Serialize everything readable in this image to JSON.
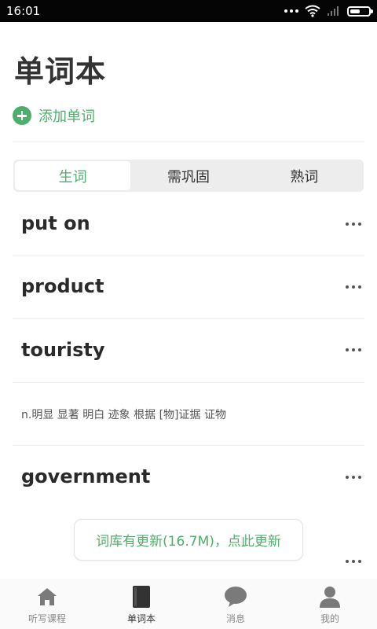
{
  "status_bar": {
    "time": "16:01"
  },
  "page": {
    "title": "单词本"
  },
  "add_word": {
    "label": "添加单词"
  },
  "tabs": [
    {
      "label": "生词",
      "active": true
    },
    {
      "label": "需巩固",
      "active": false
    },
    {
      "label": "熟词",
      "active": false
    }
  ],
  "words": [
    {
      "text": "put on"
    },
    {
      "text": "product"
    },
    {
      "text": "touristy"
    },
    {
      "definition": "n.明显 显著 明白 迹象 根据 [物]证据 证物"
    },
    {
      "text": "government"
    }
  ],
  "update_toast": {
    "text": "词库有更新(16.7M)，点此更新"
  },
  "bottom_nav": [
    {
      "label": "听写课程",
      "icon": "home-icon",
      "active": false
    },
    {
      "label": "单词本",
      "icon": "book-icon",
      "active": true
    },
    {
      "label": "消息",
      "icon": "chat-bubble-icon",
      "active": false
    },
    {
      "label": "我的",
      "icon": "person-icon",
      "active": false
    }
  ],
  "colors": {
    "accent": "#4caf6a",
    "status_bar": "#050505",
    "text": "#333333"
  }
}
